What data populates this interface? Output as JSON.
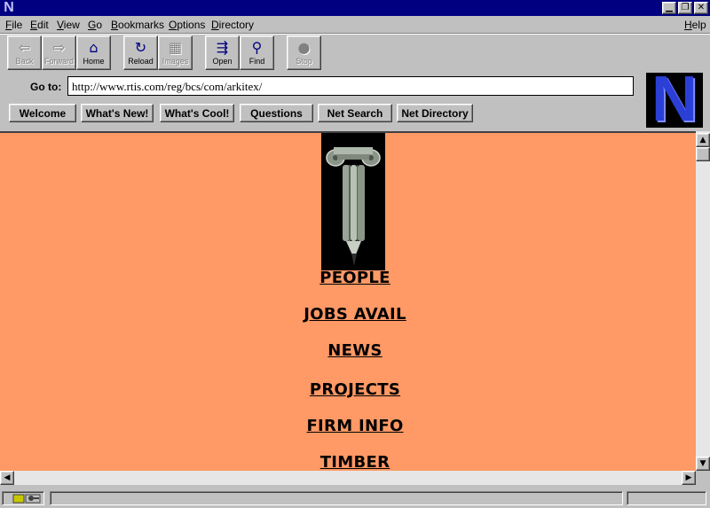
{
  "window": {
    "app_logo": "N",
    "buttons": {
      "minimize": "▁",
      "restore": "❐",
      "close": "✕"
    }
  },
  "menu": {
    "items": [
      {
        "label": "File",
        "key": "F",
        "rest": "ile"
      },
      {
        "label": "Edit",
        "key": "E",
        "rest": "dit"
      },
      {
        "label": "View",
        "key": "V",
        "rest": "iew"
      },
      {
        "label": "Go",
        "key": "G",
        "rest": "o"
      },
      {
        "label": "Bookmarks",
        "key": "B",
        "rest": "ookmarks"
      },
      {
        "label": "Options",
        "key": "O",
        "rest": "ptions"
      },
      {
        "label": "Directory",
        "key": "D",
        "rest": "irectory"
      }
    ],
    "help": {
      "label": "Help",
      "key": "H",
      "rest": "elp"
    }
  },
  "toolbar": {
    "back": {
      "label": "Back",
      "icon": "⇦",
      "icon_name": "back-arrow-icon",
      "enabled": false
    },
    "forward": {
      "label": "Forward",
      "icon": "⇨",
      "icon_name": "forward-arrow-icon",
      "enabled": false
    },
    "home": {
      "label": "Home",
      "icon": "⌂",
      "icon_name": "home-icon",
      "enabled": true
    },
    "reload": {
      "label": "Reload",
      "icon": "↻",
      "icon_name": "reload-icon",
      "enabled": true
    },
    "images": {
      "label": "Images",
      "icon": "▦",
      "icon_name": "images-icon",
      "enabled": false
    },
    "open": {
      "label": "Open",
      "icon": "⇶",
      "icon_name": "open-icon",
      "enabled": true
    },
    "find": {
      "label": "Find",
      "icon": "⚲",
      "icon_name": "binoculars-icon",
      "enabled": true
    },
    "stop": {
      "label": "Stop",
      "icon": "●",
      "icon_name": "stop-icon",
      "enabled": false
    }
  },
  "location": {
    "label": "Go to:",
    "url": "http://www.rtis.com/reg/bcs/com/arkitex/"
  },
  "directory_buttons": [
    "Welcome",
    "What's New!",
    "What's Cool!",
    "Questions",
    "Net Search",
    "Net Directory"
  ],
  "brand_logo": "N",
  "page": {
    "links": [
      "PEOPLE",
      "JOBS AVAIL",
      "NEWS",
      "PROJECTS",
      "FIRM INFO",
      "TIMBER"
    ]
  },
  "colors": {
    "title_bar": "#000080",
    "page_background": "#ff9966",
    "chrome": "#c0c0c0"
  }
}
